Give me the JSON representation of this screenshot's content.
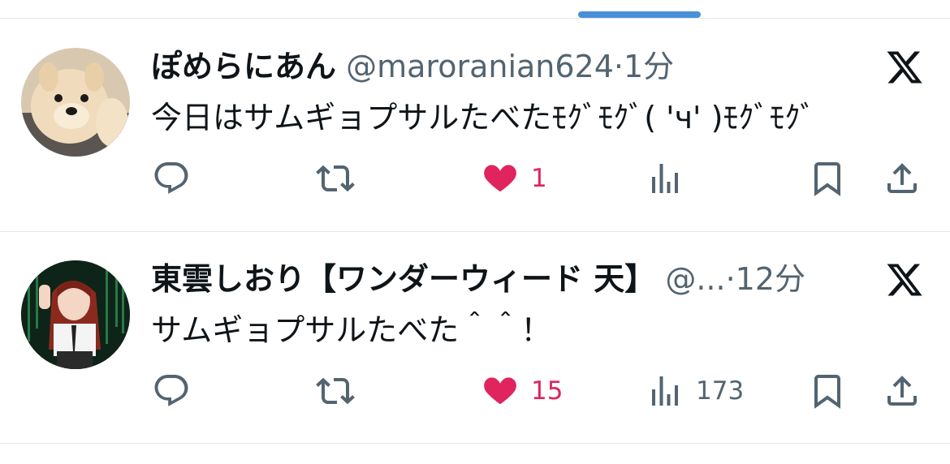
{
  "tweets": [
    {
      "name": "ぽめらにあん",
      "handle": "@maroranian624",
      "separator": "·",
      "time": "1分",
      "text": "今日はサムギョプサルたべたﾓｸﾞﾓｸﾞ( 'ч' )ﾓｸﾞﾓｸﾞ",
      "likes": "1",
      "views": "",
      "avatar_icon": "pomeranian-dog-avatar"
    },
    {
      "name": "東雲しおり【ワンダーウィード 天】",
      "handle": "@...",
      "separator": "·",
      "time": "12分",
      "text": "サムギョプサルたべた＾＾！",
      "likes": "15",
      "views": "173",
      "avatar_icon": "idol-photo-avatar"
    }
  ],
  "colors": {
    "like": "#e0245e",
    "muted": "#536471",
    "text": "#0f1419",
    "divider": "#e3e6e9",
    "scroll_indicator": "#4a90d9"
  },
  "icons": [
    "reply-icon",
    "retweet-icon",
    "like-icon",
    "views-icon",
    "bookmark-icon",
    "share-icon",
    "x-logo-icon"
  ]
}
